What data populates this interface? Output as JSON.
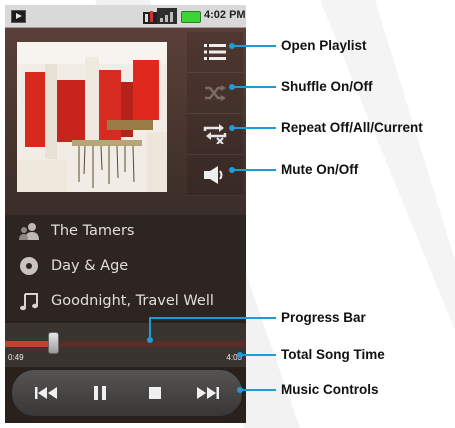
{
  "status_bar": {
    "time": "4:02 PM"
  },
  "player": {
    "artist": "The Tamers",
    "album": "Day & Age",
    "song": "Goodnight, Travel Well",
    "elapsed": "0:49",
    "total": "4:03",
    "progress_fraction": 0.2
  },
  "side_buttons": {
    "playlist_icon": "list-icon",
    "shuffle_icon": "shuffle-icon",
    "repeat_icon": "repeat-icon",
    "mute_icon": "speaker-icon"
  },
  "controls": {
    "prev_icon": "previous-icon",
    "pause_icon": "pause-icon",
    "stop_icon": "stop-icon",
    "next_icon": "next-icon"
  },
  "callouts": {
    "open_playlist": "Open Playlist",
    "shuffle": "Shuffle On/Off",
    "repeat": "Repeat Off/All/Current",
    "mute": "Mute On/Off",
    "progress": "Progress Bar",
    "total_time": "Total Song Time",
    "music_controls": "Music Controls"
  },
  "colors": {
    "callout_line": "#1e9bd8",
    "battery": "#3fd33a",
    "progress": "#c2402d"
  }
}
